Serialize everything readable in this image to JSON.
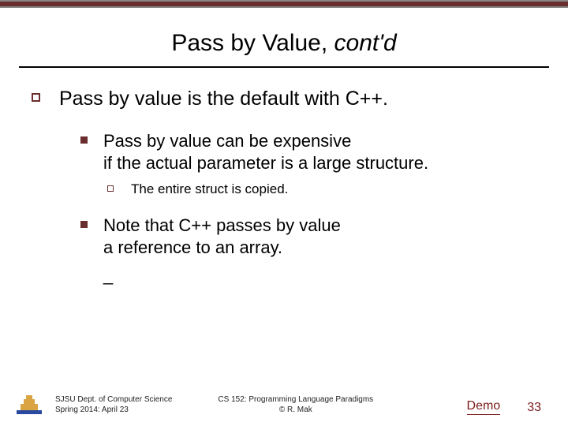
{
  "title": {
    "main": "Pass by Value, ",
    "italic": "cont'd"
  },
  "bullets": {
    "lvl1": "Pass by value is the default with C++.",
    "lvl2a_line1": "Pass by value can be expensive",
    "lvl2a_line2": "if the actual parameter is a large structure.",
    "lvl3": "The entire struct is copied.",
    "lvl2b_line1": "Note that C++ passes by value",
    "lvl2b_line2": "a reference to an array.",
    "underscore": "_"
  },
  "footer": {
    "dept_line1": "SJSU Dept. of Computer Science",
    "dept_line2": "Spring 2014: April 23",
    "course_line1": "CS 152: Programming Language Paradigms",
    "course_line2": "© R. Mak",
    "demo": "Demo",
    "page": "33"
  }
}
